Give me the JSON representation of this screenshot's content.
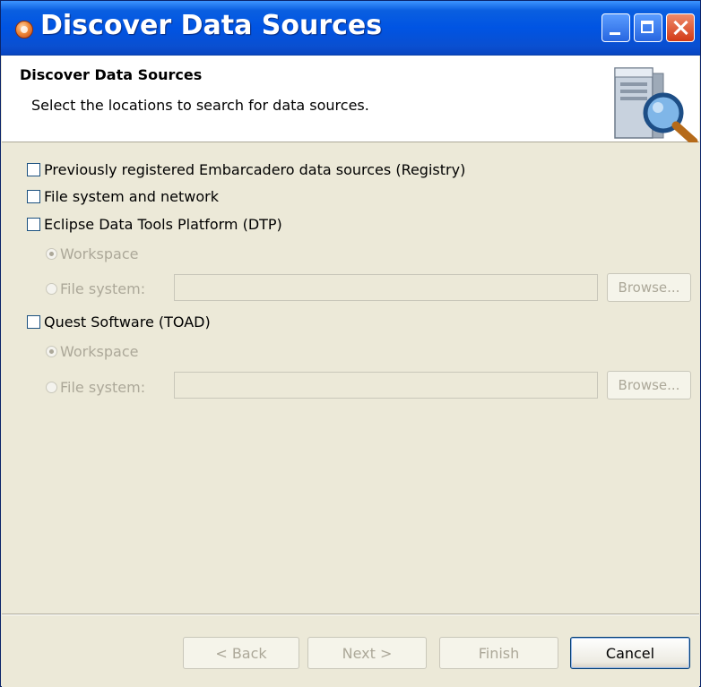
{
  "window": {
    "title": "Discover Data Sources"
  },
  "header": {
    "title": "Discover Data Sources",
    "description": "Select the locations to search for data sources.",
    "icon": "server-search-icon"
  },
  "sources": {
    "registry": {
      "label": "Previously registered Embarcadero data sources (Registry)",
      "checked": false
    },
    "filesystem": {
      "label": "File system and network",
      "checked": false
    },
    "dtp": {
      "label": "Eclipse Data Tools Platform (DTP)",
      "checked": false,
      "workspace_label": "Workspace",
      "filesystem_label": "File system:",
      "path_value": "",
      "browse_label": "Browse..."
    },
    "toad": {
      "label": "Quest Software (TOAD)",
      "checked": false,
      "workspace_label": "Workspace",
      "filesystem_label": "File system:",
      "path_value": "",
      "browse_label": "Browse..."
    }
  },
  "buttons": {
    "back": "< Back",
    "next": "Next >",
    "finish": "Finish",
    "cancel": "Cancel"
  }
}
